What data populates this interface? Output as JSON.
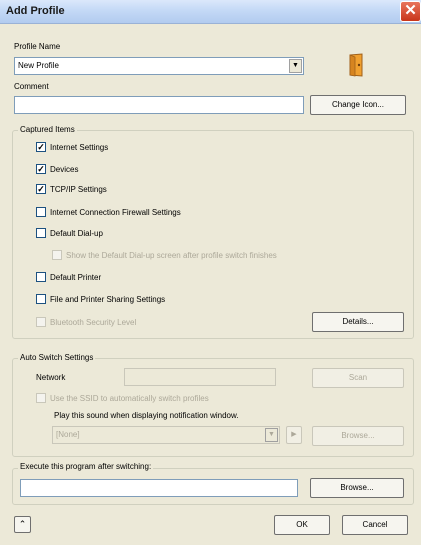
{
  "window": {
    "title": "Add Profile",
    "close_glyph": "✕"
  },
  "profile": {
    "name_label": "Profile Name",
    "name_value": "New Profile",
    "comment_label": "Comment",
    "comment_value": "",
    "change_icon_label": "Change Icon..."
  },
  "captured": {
    "group_label": "Captured Items",
    "items": [
      {
        "label": "Internet Settings",
        "checked": true,
        "enabled": true
      },
      {
        "label": "Devices",
        "checked": true,
        "enabled": true
      },
      {
        "label": "TCP/IP Settings",
        "checked": true,
        "enabled": true
      },
      {
        "label": "Internet Connection Firewall Settings",
        "checked": false,
        "enabled": true
      },
      {
        "label": "Default Dial-up",
        "checked": false,
        "enabled": true
      },
      {
        "label": "Show the Default Dial-up screen after profile switch finishes",
        "checked": false,
        "enabled": false
      },
      {
        "label": "Default Printer",
        "checked": false,
        "enabled": true
      },
      {
        "label": "File and Printer Sharing Settings",
        "checked": false,
        "enabled": true
      },
      {
        "label": "Bluetooth Security Level",
        "checked": false,
        "enabled": false
      }
    ],
    "details_label": "Details..."
  },
  "auto_switch": {
    "group_label": "Auto Switch Settings",
    "network_label": "Network",
    "network_value": "",
    "scan_label": "Scan",
    "ssid_label": "Use the SSID to automatically switch profiles",
    "sound_label": "Play this sound when displaying notification window.",
    "sound_value": "[None]",
    "play_glyph": "▶",
    "browse_label": "Browse..."
  },
  "execute": {
    "group_label": "Execute this program after switching:",
    "program_value": "",
    "browse_label": "Browse..."
  },
  "footer": {
    "collapse_glyph": "⌃",
    "ok_label": "OK",
    "cancel_label": "Cancel"
  },
  "colors": {
    "dialog_bg": "#ece9d8",
    "field_border": "#7f9db9",
    "disabled_text": "#aca899",
    "profile_icon": "#f0a030"
  },
  "icons": {
    "profile_icon": "door-icon",
    "close": "close-icon"
  }
}
